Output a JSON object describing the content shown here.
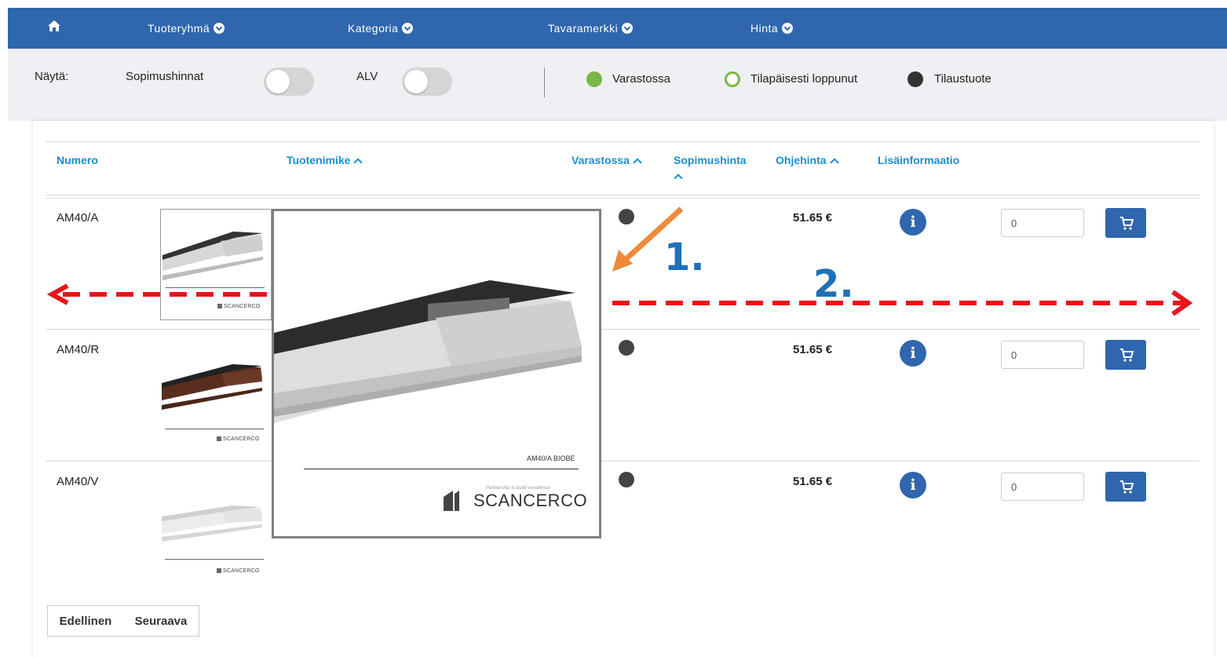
{
  "nav": {
    "items": [
      {
        "label": "Tuoteryhmä"
      },
      {
        "label": "Kategoria"
      },
      {
        "label": "Tavaramerkki"
      },
      {
        "label": "Hinta"
      }
    ]
  },
  "filters": {
    "show_label": "Näytä:",
    "contract_prices_label": "Sopimushinnat",
    "vat_label": "ALV",
    "legend": [
      {
        "label": "Varastossa",
        "color": "#7ab648"
      },
      {
        "label": "Tilapäisesti loppunut",
        "color": "#7ab648"
      },
      {
        "label": "Tilaustuote",
        "color": "#333333"
      }
    ]
  },
  "table": {
    "headers": {
      "number": "Numero",
      "title": "Tuotenimike",
      "stock": "Varastossa",
      "contract_price": "Sopimushinta",
      "list_price": "Ohjehinta",
      "more_info": "Lisäinformaatio"
    },
    "rows": [
      {
        "number": "AM40/A",
        "price": "51.65 €",
        "qty": "0",
        "info": "i",
        "brand": "SCANCERCO"
      },
      {
        "number": "AM40/R",
        "price": "51.65 €",
        "qty": "0",
        "info": "i",
        "brand": "SCANCERCO"
      },
      {
        "number": "AM40/V",
        "price": "51.65 €",
        "qty": "0",
        "info": "i",
        "brand": "SCANCERCO"
      }
    ]
  },
  "preview": {
    "model": "AM40/A BIOBE",
    "tagline": "Partnership to build excellence",
    "brand": "SCANCERCO"
  },
  "pager": {
    "prev": "Edellinen",
    "next": "Seuraava"
  },
  "annotations": {
    "one": "1.",
    "two": "2."
  }
}
